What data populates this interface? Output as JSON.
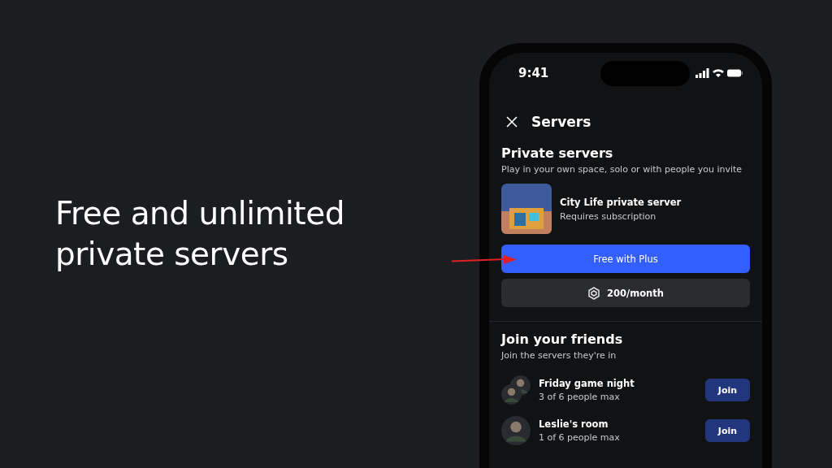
{
  "headline": "Free and unlimited private servers",
  "status_bar": {
    "time": "9:41"
  },
  "header": {
    "title": "Servers"
  },
  "private_servers": {
    "title": "Private servers",
    "subtitle": "Play in your own space, solo or with people you invite",
    "server": {
      "name": "City Life private server",
      "note": "Requires subscription"
    },
    "buttons": [
      {
        "kind": "primary",
        "label": "Free with Plus"
      },
      {
        "kind": "price",
        "label": "200/month"
      }
    ]
  },
  "friends": {
    "title": "Join your friends",
    "subtitle": "Join the servers they're in",
    "servers": [
      {
        "name": "Friday game night",
        "count": "3 of 6 people max",
        "kind": "group",
        "action": "Join"
      },
      {
        "name": "Leslie's room",
        "count": "1 of 6 people max",
        "kind": "single",
        "action": "Join"
      }
    ]
  }
}
